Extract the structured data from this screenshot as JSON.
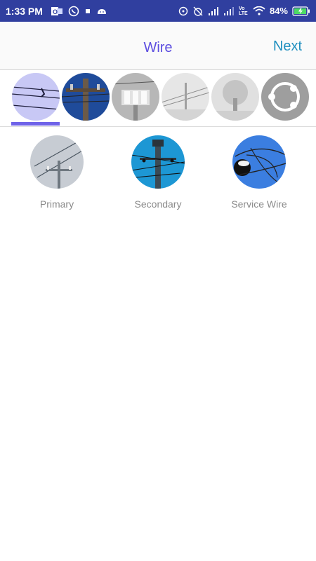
{
  "status_bar": {
    "time": "1:33 PM",
    "battery": "84%",
    "volte_label": "Vo LTE"
  },
  "header": {
    "title": "Wire",
    "next_label": "Next"
  },
  "categories": [
    {
      "icon": "wire-photo",
      "selected": true
    },
    {
      "icon": "pole-photo",
      "selected": false
    },
    {
      "icon": "transformer-photo",
      "selected": false
    },
    {
      "icon": "line-photo",
      "selected": false
    },
    {
      "icon": "tree-photo",
      "selected": false
    },
    {
      "icon": "share-icon",
      "selected": false
    }
  ],
  "subcategories": [
    {
      "label": "Primary"
    },
    {
      "label": "Secondary"
    },
    {
      "label": "Service Wire"
    }
  ],
  "colors": {
    "status_bar": "#303f9f",
    "title": "#5c4de0",
    "next": "#1f8fbf",
    "accent_underline": "#6f63e8",
    "label": "#8a8a8a"
  }
}
